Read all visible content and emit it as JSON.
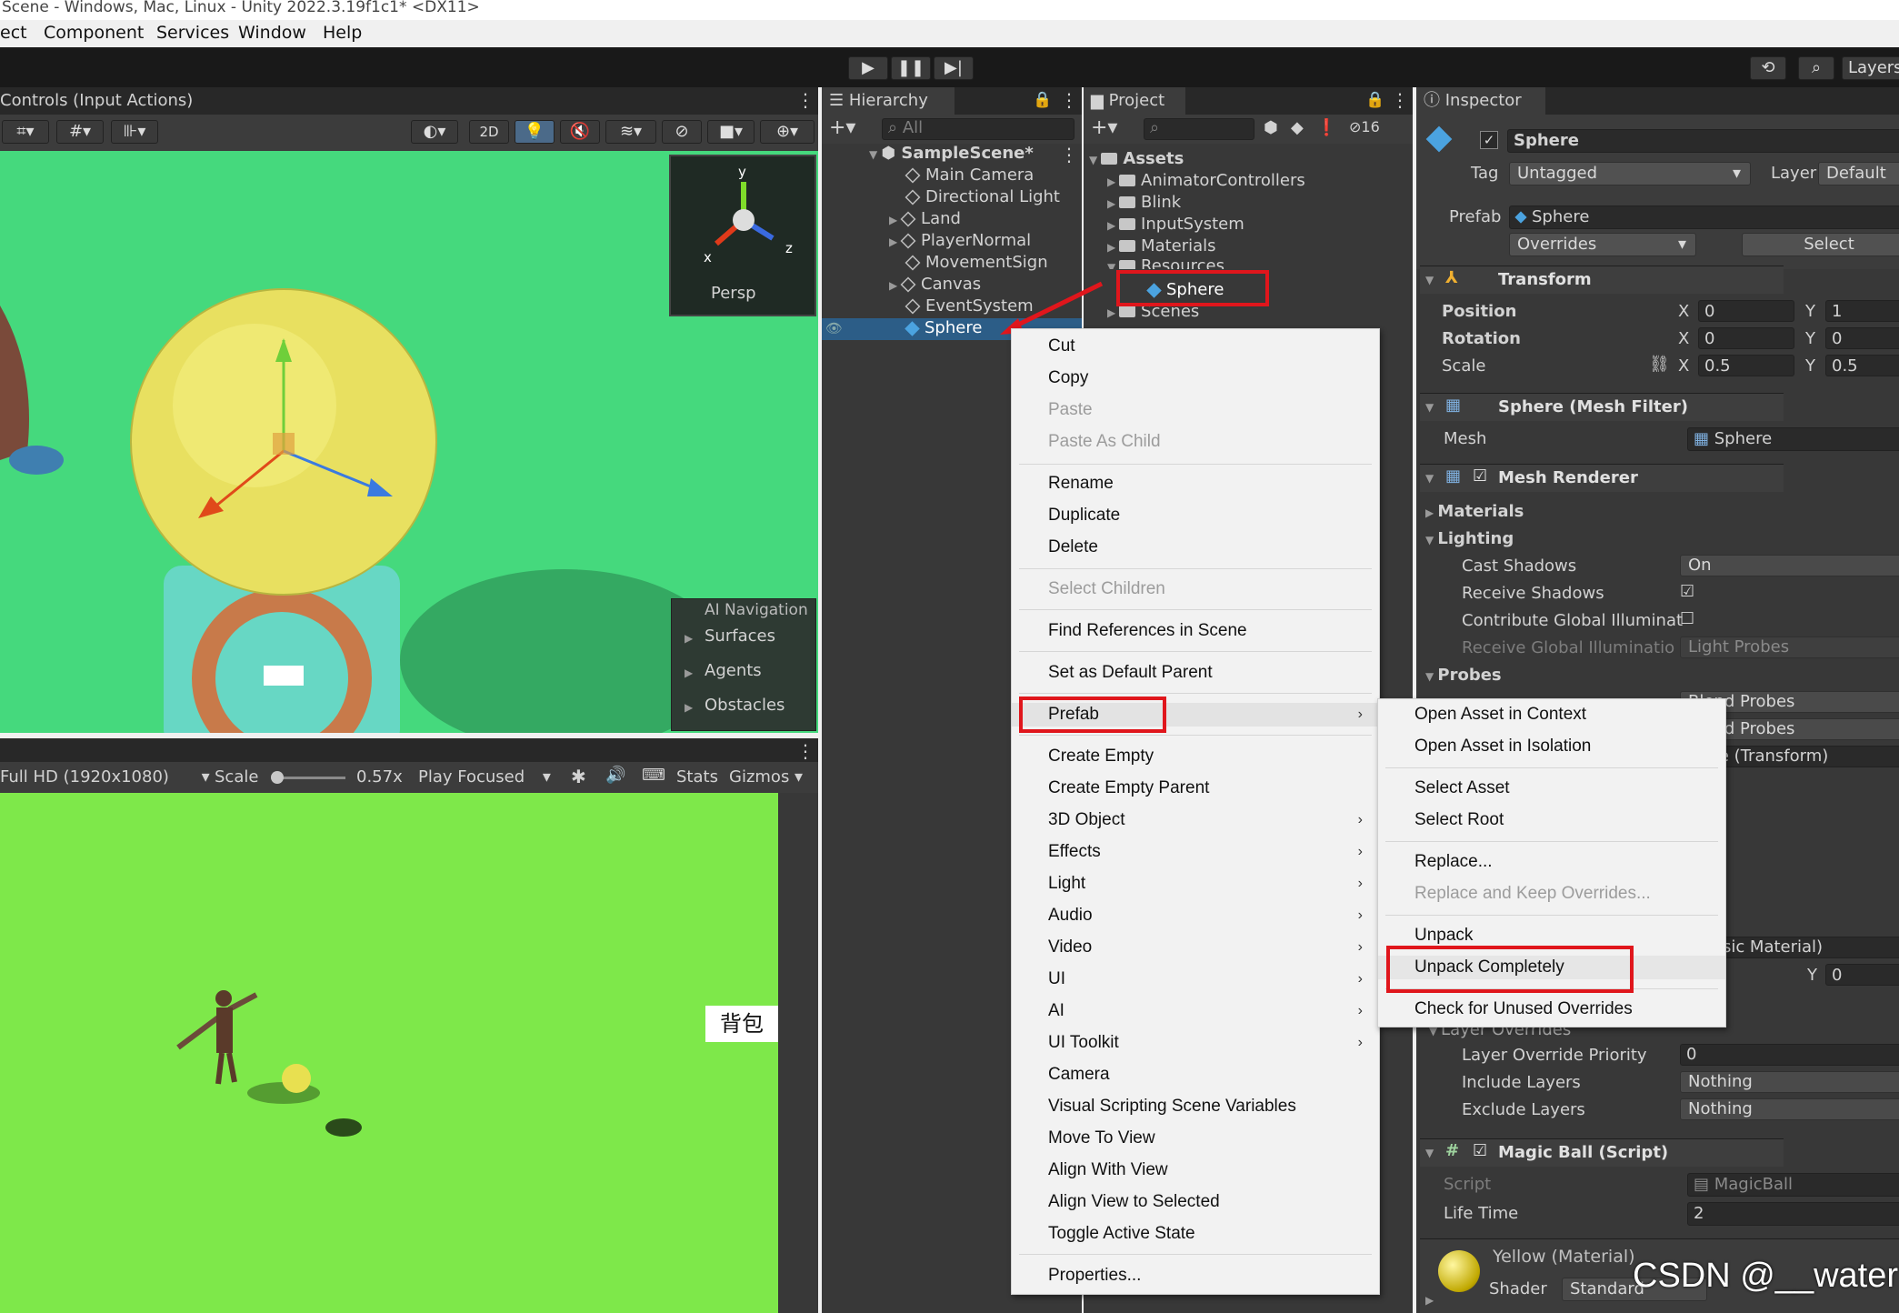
{
  "window_title": "Scene - Windows, Mac, Linux - Unity 2022.3.19f1c1* <DX11>",
  "menu": [
    "ect",
    "Component",
    "Services",
    "Window",
    "Help"
  ],
  "toolbar": {
    "play": "▶",
    "pause": "❚❚",
    "step": "▶|",
    "layers": "Layers"
  },
  "scene": {
    "tab_title": "Controls (Input Actions)",
    "btn_2d": "2D",
    "gizmo": {
      "y": "y",
      "x": "x",
      "z": "z",
      "persp": "Persp"
    },
    "ai_navigation": {
      "title": "AI Navigation",
      "items": [
        "Surfaces",
        "Agents",
        "Obstacles"
      ]
    }
  },
  "game": {
    "resolution": "Full HD (1920x1080)",
    "scale_label": "Scale",
    "scale_value": "0.57x",
    "play_mode": "Play Focused",
    "stats": "Stats",
    "gizmos": "Gizmos",
    "backpack_label": "背包"
  },
  "hierarchy": {
    "tab": "Hierarchy",
    "search_placeholder": "All",
    "scene_name": "SampleScene*",
    "items": [
      "Main Camera",
      "Directional Light",
      "Land",
      "PlayerNormal",
      "MovementSign",
      "Canvas",
      "EventSystem",
      "Sphere"
    ]
  },
  "project": {
    "tab": "Project",
    "hidden_count": "16",
    "root": "Assets",
    "items": [
      "AnimatorControllers",
      "Blink",
      "InputSystem",
      "Materials",
      "Resources",
      "Sphere",
      "Scenes"
    ]
  },
  "inspector": {
    "tab": "Inspector",
    "object_name": "Sphere",
    "tag_label": "Tag",
    "tag_value": "Untagged",
    "layer_label": "Layer",
    "layer_value": "Default",
    "prefab_label": "Prefab",
    "prefab_value": "Sphere",
    "overrides": "Overrides",
    "select": "Select",
    "transform": {
      "title": "Transform",
      "position": {
        "label": "Position",
        "x": "0",
        "y": "1"
      },
      "rotation": {
        "label": "Rotation",
        "x": "0",
        "y": "0"
      },
      "scale": {
        "label": "Scale",
        "x": "0.5",
        "y": "0.5"
      }
    },
    "mesh_filter": {
      "title": "Sphere (Mesh Filter)",
      "mesh_label": "Mesh",
      "mesh_value": "Sphere"
    },
    "mesh_renderer": {
      "title": "Mesh Renderer",
      "materials": "Materials",
      "lighting": "Lighting",
      "cast_shadows_label": "Cast Shadows",
      "cast_shadows_value": "On",
      "receive_shadows_label": "Receive Shadows",
      "contribute_gi_label": "Contribute Global Illuminat",
      "receive_gi_label": "Receive Global Illuminatio",
      "receive_gi_value": "Light Probes",
      "probes": "Probes",
      "probes_v1": "Blend Probes",
      "probes_v2": "Blend Probes",
      "transform_ref": "None (Transform)",
      "physic_material": "(Physic Material)",
      "y_label": "Y",
      "y_value": "0",
      "layer_overrides": "Layer Overrides",
      "layer_override_priority_label": "Layer Override Priority",
      "layer_override_priority_value": "0",
      "include_layers_label": "Include Layers",
      "include_layers_value": "Nothing",
      "exclude_layers_label": "Exclude Layers",
      "exclude_layers_value": "Nothing"
    },
    "script_comp": {
      "title": "Magic Ball (Script)",
      "script_label": "Script",
      "script_value": "MagicBall",
      "lifetime_label": "Life Time",
      "lifetime_value": "2"
    },
    "material": {
      "name": "Yellow (Material)",
      "shader_label": "Shader",
      "shader_value": "Standard"
    }
  },
  "context_menu": {
    "items": [
      "Cut",
      "Copy",
      "Paste",
      "Paste As Child",
      "Rename",
      "Duplicate",
      "Delete",
      "Select Children",
      "Find References in Scene",
      "Set as Default Parent",
      "Prefab",
      "Create Empty",
      "Create Empty Parent",
      "3D Object",
      "Effects",
      "Light",
      "Audio",
      "Video",
      "UI",
      "AI",
      "UI Toolkit",
      "Camera",
      "Visual Scripting Scene Variables",
      "Move To View",
      "Align With View",
      "Align View to Selected",
      "Toggle Active State",
      "Properties..."
    ]
  },
  "submenu": {
    "items": [
      "Open Asset in Context",
      "Open Asset in Isolation",
      "Select Asset",
      "Select Root",
      "Replace...",
      "Replace and Keep Overrides...",
      "Unpack",
      "Unpack Completely",
      "Check for Unused Overrides"
    ]
  },
  "watermark": "CSDN @__water",
  "colors": {
    "highlight": "#e0161c",
    "selection": "#2c5d87",
    "scene_bg": "#45d97d",
    "game_bg": "#7ee84a"
  }
}
